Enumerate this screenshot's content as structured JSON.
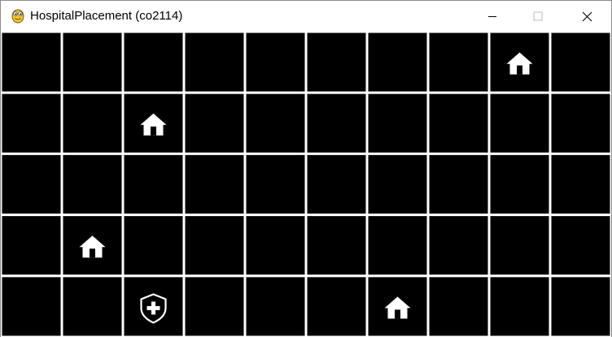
{
  "window": {
    "title": "HospitalPlacement (co2114)",
    "controls": [
      "minimize",
      "maximize",
      "close"
    ]
  },
  "board": {
    "columns": 10,
    "rows": 5,
    "cell_color": "#000000",
    "line_color": "#ffffff",
    "items": [
      {
        "type": "house",
        "icon": "house-icon",
        "row": 0,
        "col": 8
      },
      {
        "type": "house",
        "icon": "house-icon",
        "row": 1,
        "col": 2
      },
      {
        "type": "house",
        "icon": "house-icon",
        "row": 3,
        "col": 1
      },
      {
        "type": "hospital",
        "icon": "hospital-shield-icon",
        "row": 4,
        "col": 2
      },
      {
        "type": "house",
        "icon": "house-icon",
        "row": 4,
        "col": 6
      }
    ]
  }
}
